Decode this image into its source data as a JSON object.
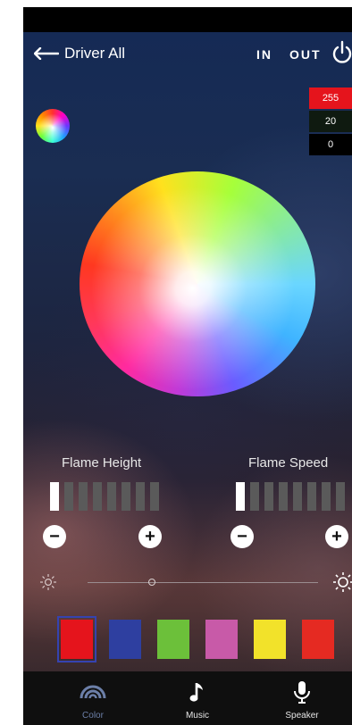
{
  "header": {
    "back_label": "Driver All",
    "in_label": "IN",
    "out_label": "OUT"
  },
  "rgb_values": {
    "r": "255",
    "g": "20",
    "b": "0"
  },
  "sliders": {
    "flame_height": {
      "label": "Flame Height",
      "level_segments": 1,
      "total_segments": 8
    },
    "flame_speed": {
      "label": "Flame Speed",
      "level_segments": 1,
      "total_segments": 8
    }
  },
  "brightness": {
    "value_fraction": 0.28
  },
  "color_presets": [
    {
      "color": "#e5141c",
      "selected": true
    },
    {
      "color": "#2e3fa0",
      "selected": false
    },
    {
      "color": "#6cc03a",
      "selected": false
    },
    {
      "color": "#c85aa8",
      "selected": false
    },
    {
      "color": "#f2e22a",
      "selected": false
    },
    {
      "color": "#e52a22",
      "selected": false
    }
  ],
  "tabs": [
    {
      "label": "Color",
      "icon": "rainbow-icon",
      "active": true
    },
    {
      "label": "Music",
      "icon": "music-note-icon",
      "active": false
    },
    {
      "label": "Speaker",
      "icon": "microphone-icon",
      "active": false
    }
  ],
  "colors": {
    "accent_red": "#e5141c",
    "active_tab": "#6c7fa8"
  }
}
